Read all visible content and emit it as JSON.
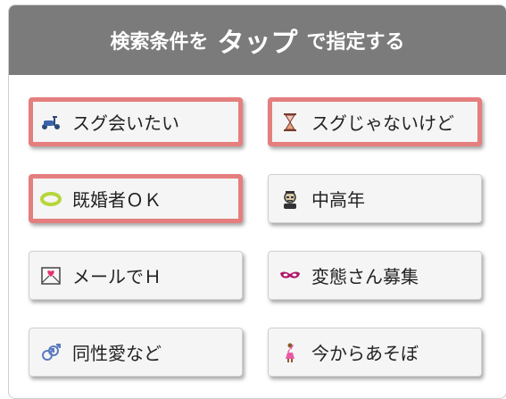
{
  "header": {
    "prefix": "検索条件を",
    "emphasis": "タップ",
    "suffix": "で指定する"
  },
  "options": [
    {
      "label": "スグ会いたい",
      "icon": "scooter-icon",
      "selected": true
    },
    {
      "label": "スグじゃないけど",
      "icon": "hourglass-icon",
      "selected": true
    },
    {
      "label": "既婚者ＯＫ",
      "icon": "ring-icon",
      "selected": true
    },
    {
      "label": "中高年",
      "icon": "man-face-icon",
      "selected": false
    },
    {
      "label": "メールでＨ",
      "icon": "love-letter-icon",
      "selected": false
    },
    {
      "label": "変態さん募集",
      "icon": "mask-icon",
      "selected": false
    },
    {
      "label": "同性愛など",
      "icon": "gender-icon",
      "selected": false
    },
    {
      "label": "今からあそぼ",
      "icon": "dancer-icon",
      "selected": false
    }
  ],
  "colors": {
    "header_bg": "#7b7b7b",
    "selected_border": "#e57e7e",
    "button_bg": "#f5f5f5"
  }
}
